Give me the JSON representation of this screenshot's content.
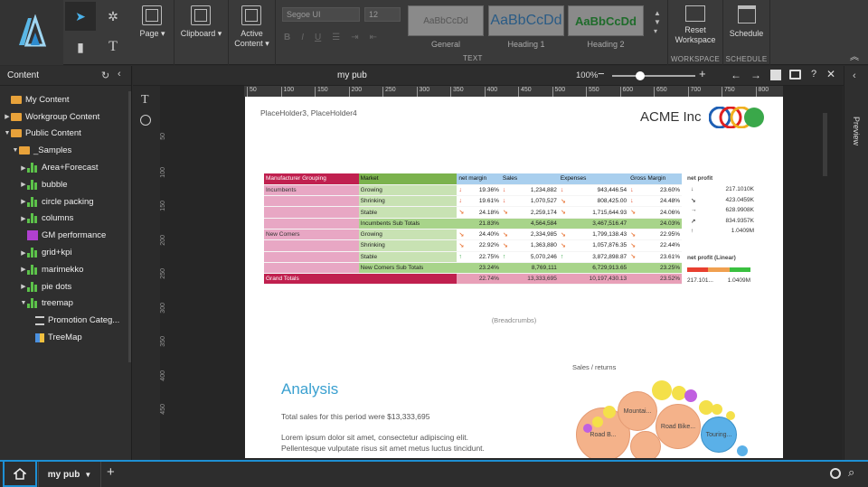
{
  "ribbon": {
    "page_label": "Page ▾",
    "clipboard_label": "Clipboard ▾",
    "active_content_label_1": "Active",
    "active_content_label_2": "Content ▾",
    "font_name": "Segoe UI",
    "font_size": "12",
    "styles": [
      {
        "preview": "AaBbCcDd",
        "label": "General"
      },
      {
        "preview": "AaBbCcDd",
        "label": "Heading 1"
      },
      {
        "preview": "AaBbCcDd",
        "label": "Heading 2"
      }
    ],
    "text_group": "TEXT",
    "reset_label_1": "Reset",
    "reset_label_2": "Workspace",
    "workspace_group": "WORKSPACE",
    "schedule_label": "Schedule",
    "schedule_group": "SCHEDULE"
  },
  "sidebar": {
    "title": "Content",
    "items": [
      {
        "label": "My Content",
        "level": 1,
        "icon": "folder",
        "caret": ""
      },
      {
        "label": "Workgroup Content",
        "level": 1,
        "icon": "folder",
        "caret": "▶"
      },
      {
        "label": "Public Content",
        "level": 1,
        "icon": "folder",
        "caret": "▼"
      },
      {
        "label": "_Samples",
        "level": 2,
        "icon": "folder",
        "caret": "▼"
      },
      {
        "label": "Area+Forecast",
        "level": 3,
        "icon": "bars",
        "caret": "▶"
      },
      {
        "label": "bubble",
        "level": 3,
        "icon": "bars",
        "caret": "▶"
      },
      {
        "label": "circle packing",
        "level": 3,
        "icon": "bars",
        "caret": "▶"
      },
      {
        "label": "columns",
        "level": 3,
        "icon": "bars",
        "caret": "▶"
      },
      {
        "label": "GM performance",
        "level": 3,
        "icon": "gm",
        "caret": ""
      },
      {
        "label": "grid+kpi",
        "level": 3,
        "icon": "bars",
        "caret": "▶"
      },
      {
        "label": "marimekko",
        "level": 3,
        "icon": "bars",
        "caret": "▶"
      },
      {
        "label": "pie dots",
        "level": 3,
        "icon": "bars",
        "caret": "▶"
      },
      {
        "label": "treemap",
        "level": 3,
        "icon": "bars",
        "caret": "▼"
      },
      {
        "label": "Promotion Categ...",
        "level": 4,
        "icon": "list",
        "caret": ""
      },
      {
        "label": "TreeMap",
        "level": 4,
        "icon": "tree",
        "caret": ""
      }
    ]
  },
  "editor": {
    "title": "my pub",
    "zoom": "100%",
    "ruler": [
      "50",
      "100",
      "150",
      "200",
      "250",
      "300",
      "350",
      "400",
      "450",
      "500",
      "550",
      "600",
      "650",
      "700",
      "750",
      "800"
    ],
    "vruler": [
      "50",
      "100",
      "150",
      "200",
      "250",
      "300",
      "350",
      "400",
      "450"
    ]
  },
  "preview_label": "Preview",
  "page": {
    "placeholder": "PlaceHolder3, PlaceHolder4",
    "company": "ACME Inc",
    "breadcrumbs": "(Breadcrumbs)",
    "analysis_title": "Analysis",
    "total_sales": "Total sales for this period were $13,333,695",
    "lorem_1": "Lorem ipsum dolor sit amet, consectetur adipiscing elit.",
    "lorem_2": "Pellentesque vulputate risus sit amet metus luctus tincidunt.",
    "bubble_title": "Sales / returns",
    "bubbles": [
      "Road B...",
      "Mountai...",
      "Road Bike...",
      "Touring..."
    ]
  },
  "table": {
    "headers": [
      "Manufacturer Grouping",
      "Market",
      "net margin",
      "Sales",
      "Expenses",
      "Gross Margin"
    ],
    "rows": [
      {
        "group": "Incumbents",
        "market": "Growing",
        "a1": "down",
        "nm": "19.36%",
        "a2": "down",
        "sales": "1,234,882",
        "a3": "down",
        "exp": "943,446.54",
        "a4": "down",
        "gm": "23.60%",
        "type": "row"
      },
      {
        "group": "",
        "market": "Shrinking",
        "a1": "down",
        "nm": "19.61%",
        "a2": "down",
        "sales": "1,070,527",
        "a3": "side",
        "exp": "808,425.00",
        "a4": "down",
        "gm": "24.48%",
        "type": "row"
      },
      {
        "group": "",
        "market": "Stable",
        "a1": "side",
        "nm": "24.18%",
        "a2": "side",
        "sales": "2,259,174",
        "a3": "side",
        "exp": "1,715,644.93",
        "a4": "side",
        "gm": "24.06%",
        "type": "row"
      },
      {
        "group": "",
        "market": "Incumbents Sub Totals",
        "a1": "",
        "nm": "21.83%",
        "a2": "",
        "sales": "4,564,584",
        "a3": "",
        "exp": "3,467,516.47",
        "a4": "",
        "gm": "24.03%",
        "type": "sub"
      },
      {
        "group": "New Comers",
        "market": "Growing",
        "a1": "side",
        "nm": "24.40%",
        "a2": "side",
        "sales": "2,334,985",
        "a3": "side",
        "exp": "1,799,138.43",
        "a4": "side",
        "gm": "22.95%",
        "type": "row"
      },
      {
        "group": "",
        "market": "Shrinking",
        "a1": "side",
        "nm": "22.92%",
        "a2": "side",
        "sales": "1,363,880",
        "a3": "side",
        "exp": "1,057,876.35",
        "a4": "side",
        "gm": "22.44%",
        "type": "row"
      },
      {
        "group": "",
        "market": "Stable",
        "a1": "up",
        "nm": "22.75%",
        "a2": "up",
        "sales": "5,070,246",
        "a3": "up",
        "exp": "3,872,898.87",
        "a4": "side",
        "gm": "23.61%",
        "type": "row"
      },
      {
        "group": "",
        "market": "New Comers Sub Totals",
        "a1": "",
        "nm": "23.24%",
        "a2": "",
        "sales": "8,769,111",
        "a3": "",
        "exp": "6,729,913.65",
        "a4": "",
        "gm": "23.25%",
        "type": "sub"
      },
      {
        "group": "Grand Totals",
        "market": "",
        "a1": "",
        "nm": "22.74%",
        "a2": "",
        "sales": "13,333,695",
        "a3": "",
        "exp": "10,197,430.13",
        "a4": "",
        "gm": "23.52%",
        "type": "grand"
      }
    ]
  },
  "net_profit": {
    "title": "net profit",
    "rows": [
      {
        "arrow": "↓",
        "value": "217.1010K"
      },
      {
        "arrow": "↘",
        "value": "423.0459K"
      },
      {
        "arrow": "→",
        "value": "628.9908K"
      },
      {
        "arrow": "↗",
        "value": "834.9357K"
      },
      {
        "arrow": "↑",
        "value": "1.0409M"
      }
    ],
    "linear_title": "net profit (Linear)",
    "linear_min": "217.101...",
    "linear_max": "1.0409M"
  },
  "bottom": {
    "tab": "my pub"
  },
  "colors": {
    "accent": "#1e90d4",
    "pink": "#e8a7c4",
    "crimson": "#c0204f",
    "green": "#7bb24d",
    "lightgreen": "#c8e2b3",
    "blue": "#a9cfee"
  }
}
